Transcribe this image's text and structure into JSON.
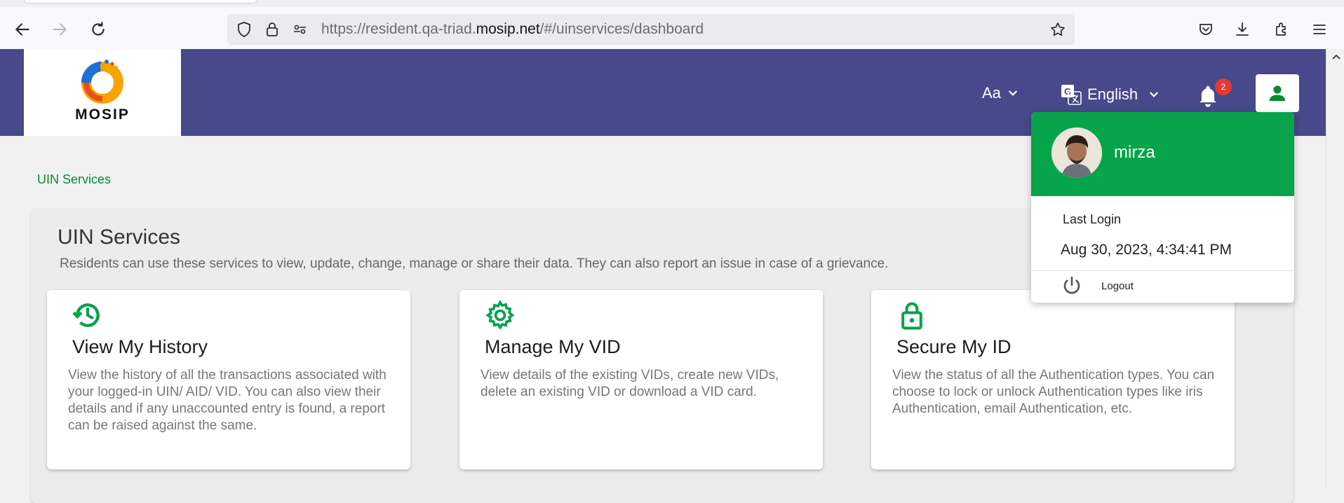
{
  "browser": {
    "url_prefix": "https://resident.qa-triad.",
    "url_host": "mosip.net",
    "url_suffix": "/#/uinservices/dashboard"
  },
  "header": {
    "logo_text": "MOSIP",
    "font_size_label": "Aa",
    "language": "English",
    "notification_count": "2",
    "accent_color": "#47498a"
  },
  "breadcrumb": "UIN Services",
  "main": {
    "title": "UIN Services",
    "description": "Residents can use these services to view, update, change, manage or share their data. They can also report an issue in case of a grievance.",
    "cards": [
      {
        "icon": "history-icon",
        "title": "View My History",
        "description": "View the history of all the transactions associated with your logged-in UIN/ AID/ VID. You can also view their details and if any unaccounted entry is found, a report can be raised against the same."
      },
      {
        "icon": "gear-icon",
        "title": "Manage My VID",
        "description": "View details of the existing VIDs, create new VIDs, delete an existing VID or download a VID card."
      },
      {
        "icon": "lock-icon",
        "title": "Secure My ID",
        "description": "View the status of all the Authentication types. You can choose to lock or unlock Authentication types like iris Authentication, email Authentication, etc."
      }
    ]
  },
  "profile_menu": {
    "name": "mirza",
    "last_login_label": "Last Login",
    "last_login_value": "Aug 30, 2023, 4:34:41 PM",
    "logout_label": "Logout",
    "accent_color": "#07a44b"
  }
}
